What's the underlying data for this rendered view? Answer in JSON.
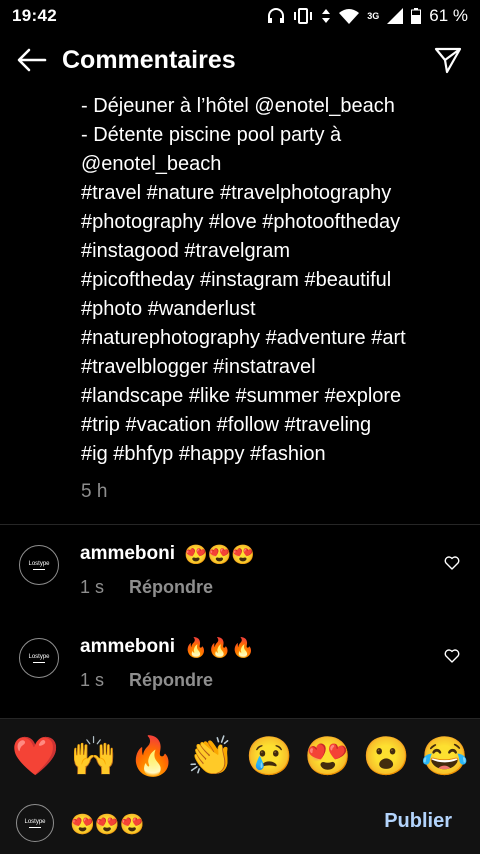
{
  "status": {
    "time": "19:42",
    "network": "3G",
    "battery": "61 %"
  },
  "header": {
    "title": "Commentaires"
  },
  "caption": {
    "lines": [
      "- Déjeuner à l’hôtel @enotel_beach",
      "- Détente piscine pool party à",
      "@enotel_beach",
      "#travel #nature #travelphotography",
      "#photography #love #photooftheday",
      "#instagood #travelgram",
      "#picoftheday #instagram #beautiful",
      "#photo #wanderlust",
      "#naturephotography #adventure #art",
      "#travelblogger #instatravel",
      "#landscape #like #summer #explore",
      "#trip #vacation #follow #traveling",
      "#ig #bhfyp #happy #fashion"
    ],
    "time": "5 h"
  },
  "comments": [
    {
      "user": "ammeboni",
      "text": "😍😍😍",
      "time": "1 s",
      "reply": "Répondre",
      "avatar_text": "Lostype"
    },
    {
      "user": "ammeboni",
      "text": "🔥🔥🔥",
      "time": "1 s",
      "reply": "Répondre",
      "avatar_text": "Lostype"
    }
  ],
  "emoji_bar": [
    "❤️",
    "🙌",
    "🔥",
    "👏",
    "😢",
    "😍",
    "😮",
    "😂"
  ],
  "input": {
    "value": "😍😍😍",
    "publish_label": "Publier",
    "avatar_text": "Lostype"
  },
  "colors": {
    "background": "#000000",
    "secondary_text": "#8e8e8e",
    "publish": "#b3d4fc",
    "heart_red": "#ed4956"
  }
}
